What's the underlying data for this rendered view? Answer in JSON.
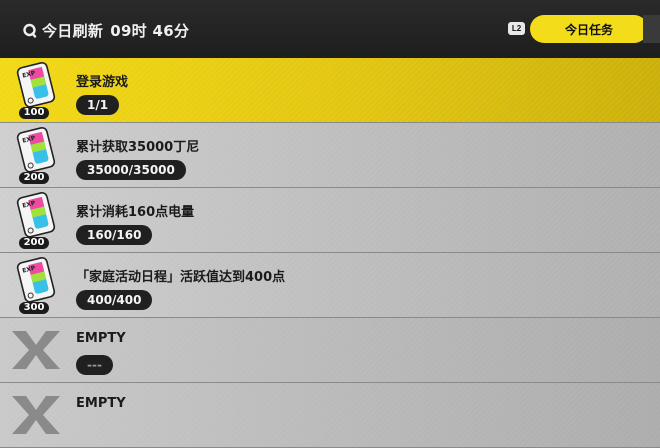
{
  "header": {
    "refresh_label": "今日刷新",
    "refresh_time": "09时 46分",
    "button_hint": "L2",
    "tab_label": "今日任务"
  },
  "tasks": [
    {
      "title": "登录游戏",
      "progress": "1/1",
      "reward": "100",
      "highlight": true
    },
    {
      "title": "累计获取35000丁尼",
      "progress": "35000/35000",
      "reward": "200"
    },
    {
      "title": "累计消耗160点电量",
      "progress": "160/160",
      "reward": "200"
    },
    {
      "title": "「家庭活动日程」活跃值达到400点",
      "progress": "400/400",
      "reward": "300"
    },
    {
      "title": "EMPTY",
      "progress": "---",
      "empty": true
    },
    {
      "title": "EMPTY",
      "empty": true
    }
  ],
  "colors": {
    "accent": "#f3dc1a",
    "header_bg": "#1e1e1e",
    "row_bg": "#c4c4c4",
    "pill_bg": "#202020"
  }
}
